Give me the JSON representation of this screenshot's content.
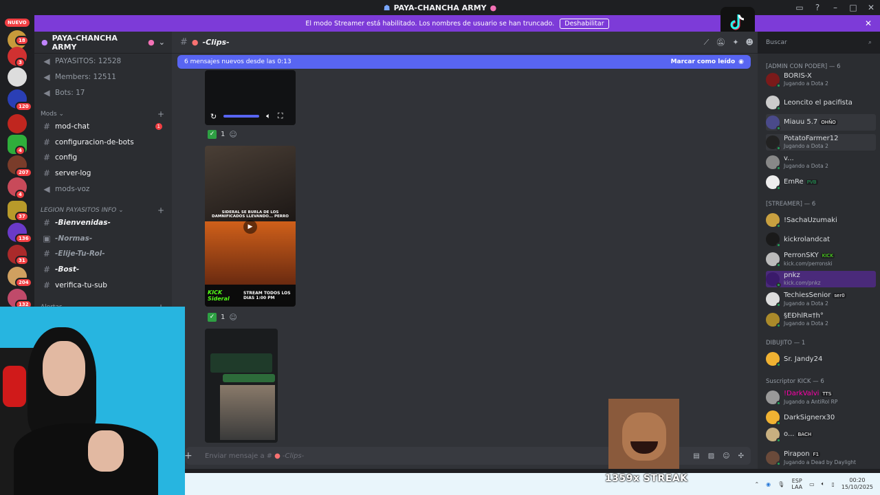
{
  "window": {
    "title": "PAYA-CHANCHA ARMY"
  },
  "banner": {
    "text": "El modo Streamer está habilitado. Los nombres de usuario se han truncado.",
    "button": "Deshabilitar"
  },
  "guilds": {
    "new_badge": "NUEVO",
    "badges": [
      "18",
      "3",
      "120",
      "4",
      "207",
      "4",
      "37",
      "136",
      "31",
      "204",
      "132"
    ]
  },
  "server": {
    "name": "PAYA-CHANCHA ARMY"
  },
  "channels": {
    "stats": [
      "PAYASITOS: 12528",
      "Members: 12511",
      "Bots: 17"
    ],
    "mods_category": "Mods",
    "mods": [
      "mod-chat",
      "configuracion-de-bots",
      "config",
      "server-log",
      "mods-voz"
    ],
    "mod_chat_unread": "1",
    "legion_category": "LEGION PAYASITOS INFO",
    "legion": [
      "-Bienvenidas-",
      "-Normas-",
      "-Elije-Tu-Rol-",
      "-Bost-",
      "verifica-tu-sub"
    ],
    "alerts_category": "Alertas"
  },
  "chat": {
    "channel_name": "-Clips-",
    "new_messages": "6 mensajes nuevos desde las 0:13",
    "mark_read": "Marcar como leído",
    "reaction_count": "1",
    "composer_placeholder": "Enviar mensaje a #",
    "clip_caption": "SIDERAL SE BURLA DE LOS DAMNIFICADOS LLEVANDO... PERRO",
    "kick_label": "KICK Sideral",
    "stream_text": "STREAM TODOS LOS DIAS 1:00 PM"
  },
  "search": {
    "placeholder": "Buscar"
  },
  "members": {
    "groups": [
      {
        "title": "[ADMIN CON PODER] — 6"
      },
      {
        "title": "[STREAMER] — 6"
      },
      {
        "title": "DIBUJITO — 1"
      },
      {
        "title": "Suscriptor KICK — 6"
      }
    ],
    "admins": [
      {
        "name": "BORIS-X",
        "sub": "Jugando a Dota 2"
      },
      {
        "name": "Leoncito el pacifista",
        "sub": ""
      },
      {
        "name": "Miauu 5.7",
        "sub": "",
        "tag": "OHÑO"
      },
      {
        "name": "PotatoFarmer12",
        "sub": "Jugando a Dota 2"
      },
      {
        "name": "v...",
        "sub": "Jugando a Dota 2"
      },
      {
        "name": "EmRe",
        "sub": "",
        "tag": "PVB"
      }
    ],
    "streamers": [
      {
        "name": "!SachaUzumaki",
        "sub": ""
      },
      {
        "name": "kickrolandcat",
        "sub": ""
      },
      {
        "name": "PerronSKY",
        "sub": "kick.com/perronski",
        "tag": "KICK"
      },
      {
        "name": "pnkz",
        "sub": "kick.com/pnkz"
      },
      {
        "name": "TechiesSenior",
        "sub": "Jugando a Dota 2",
        "tag": "ser0"
      },
      {
        "name": "§ЕÐhlR¤†h°",
        "sub": "Jugando a Dota 2"
      }
    ],
    "dibujito": [
      {
        "name": "Sr. Jandy24",
        "sub": ""
      }
    ],
    "kick_subs": [
      {
        "name": "!DarkValvi",
        "sub": "Jugando a AntiRol RP",
        "tag": "TTS"
      },
      {
        "name": "DarkSignerx30",
        "sub": ""
      },
      {
        "name": "o...",
        "sub": "",
        "tag": "BACH"
      },
      {
        "name": "Pirapon",
        "sub": "Jugando a Dead by Daylight",
        "tag": "F1"
      }
    ]
  },
  "overlay": {
    "streak": "1359x STREAK"
  },
  "taskbar": {
    "lang1": "ESP",
    "lang2": "LAA",
    "time": "00:20",
    "date": "15/10/2025"
  },
  "colors": {
    "accent": "#5865f2",
    "banner": "#7d3bd8",
    "online": "#23a55a",
    "badge": "#f23f43"
  }
}
